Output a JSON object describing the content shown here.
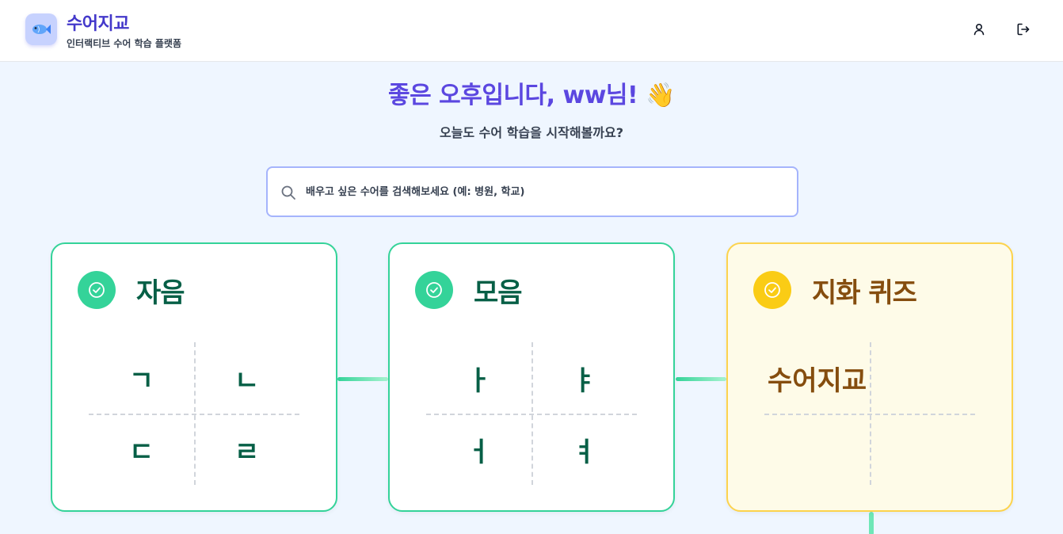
{
  "header": {
    "brand_name": "수어지교",
    "brand_sub": "인터랙티브 수어 학습 플랫폼",
    "logo_icon": "fish-icon",
    "profile_icon": "user-icon",
    "logout_icon": "logout-icon"
  },
  "greeting": "좋은 오후입니다, ww님! 👋",
  "subgreeting": "오늘도 수어 학습을 시작해볼까요?",
  "search": {
    "placeholder": "배우고 싶은 수어를 검색해보세요 (예: 병원, 학교)",
    "value": ""
  },
  "cards": [
    {
      "title": "자음",
      "status": "completed",
      "chars": [
        "ㄱ",
        "ㄴ",
        "ㄷ",
        "ㄹ"
      ]
    },
    {
      "title": "모음",
      "status": "completed",
      "chars": [
        "ㅏ",
        "ㅑ",
        "ㅓ",
        "ㅕ"
      ]
    },
    {
      "title": "지화 퀴즈",
      "status": "in-progress",
      "chars": [
        "수어지교",
        "",
        "",
        ""
      ]
    }
  ],
  "colors": {
    "accent": "#5b47e0",
    "completed": "#34d399",
    "quiz": "#facc15",
    "background": "#eff6ff"
  }
}
